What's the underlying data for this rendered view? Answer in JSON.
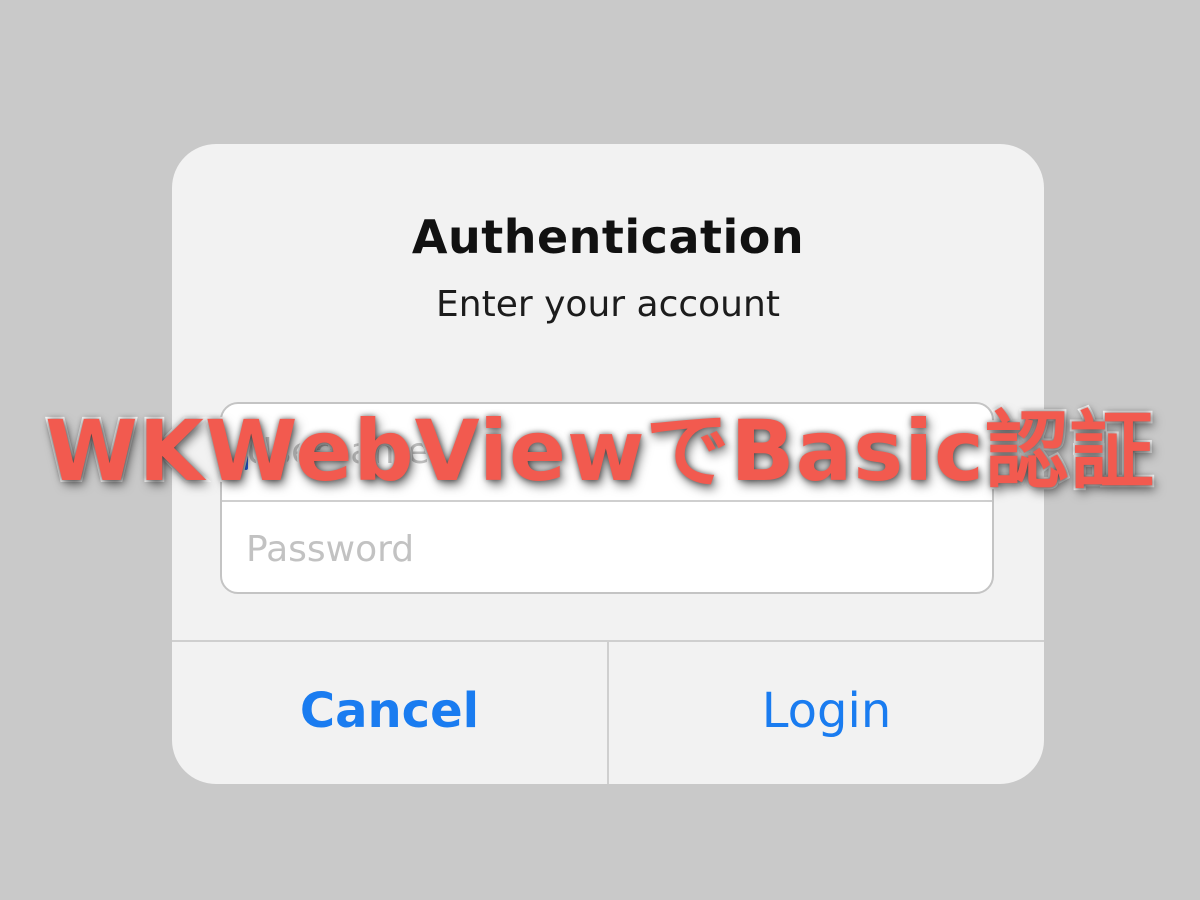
{
  "alert": {
    "title": "Authentication",
    "message": "Enter your account",
    "username_placeholder": "Username",
    "username_value": "",
    "password_placeholder": "Password",
    "password_value": "",
    "cancel_label": "Cancel",
    "login_label": "Login"
  },
  "overlay": {
    "title": "WKWebViewでBasic認証"
  },
  "colors": {
    "background": "#c9c9c9",
    "alert_background": "#f2f2f2",
    "button_text": "#1a7cf0",
    "overlay_text": "#f25a4f",
    "caret": "#2a66f2"
  }
}
